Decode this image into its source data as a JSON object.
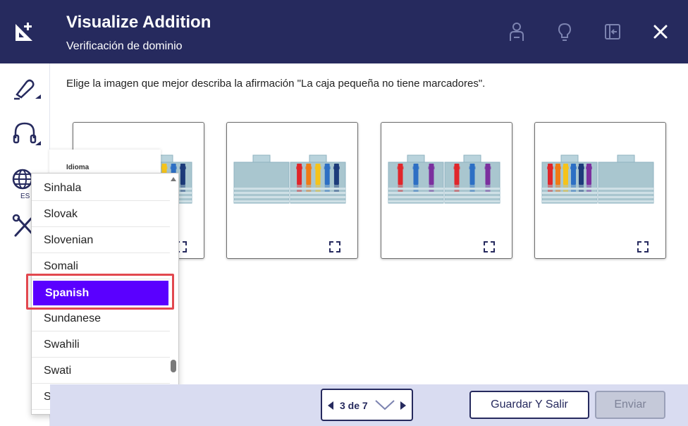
{
  "header": {
    "title": "Visualize Addition",
    "subtitle": "Verificación de dominio",
    "icons": [
      "logo-icon",
      "text-to-speech-icon",
      "hint-icon",
      "exit-panel-icon",
      "close-icon"
    ]
  },
  "rail": {
    "items": [
      "highlighter-icon",
      "headphones-icon",
      "globe-icon",
      "tools-icon"
    ],
    "language_code": "ES"
  },
  "prompt": "Elige la imagen que mejor describa la afirmación \"La caja pequeña no tiene marcadores\".",
  "options": [
    {
      "id": 1,
      "left_markers": 3,
      "right_markers": 5
    },
    {
      "id": 2,
      "left_markers": 0,
      "right_markers": 5
    },
    {
      "id": 3,
      "left_markers": 3,
      "right_markers": 3
    },
    {
      "id": 4,
      "left_markers": 6,
      "right_markers": 0
    }
  ],
  "dropdown": {
    "label": "Idioma",
    "items": [
      "Sinhala",
      "Slovak",
      "Slovenian",
      "Somali",
      "Spanish",
      "Sundanese",
      "Swahili",
      "Swati",
      "Swedish"
    ],
    "selected": "Spanish"
  },
  "footer": {
    "pager": "3 de 7",
    "save_label": "Guardar Y Salir",
    "submit_label": "Enviar"
  },
  "colors": {
    "header_bg": "#262a5e",
    "footer_bg": "#d9dcf1",
    "selected_bg": "#5a00ff",
    "highlight_border": "#e2484f"
  }
}
